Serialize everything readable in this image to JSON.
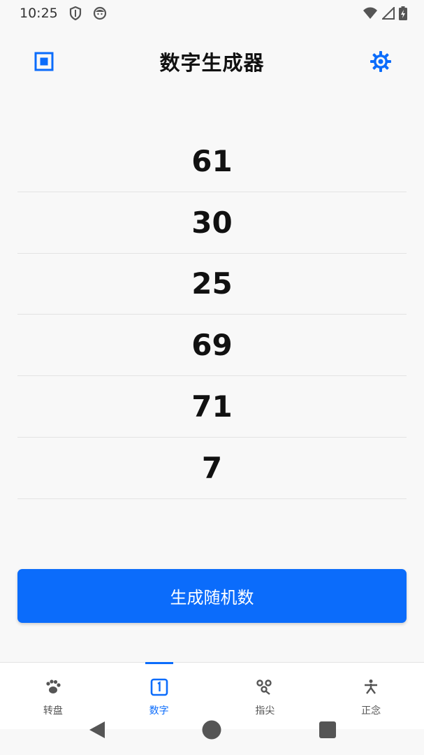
{
  "status_bar": {
    "time": "10:25",
    "icons": [
      "shield-icon",
      "face-icon",
      "wifi-icon",
      "signal-icon",
      "battery-charging-icon"
    ]
  },
  "app_bar": {
    "title": "数字生成器",
    "left_icon": "stop-square-icon",
    "right_icon": "gear-icon"
  },
  "numbers": [
    "61",
    "30",
    "25",
    "69",
    "71",
    "7"
  ],
  "generate_button": {
    "label": "生成随机数"
  },
  "bottom_nav": {
    "items": [
      {
        "label": "转盘",
        "icon": "paw-icon",
        "active": false
      },
      {
        "label": "数字",
        "icon": "number-one-box-icon",
        "active": true
      },
      {
        "label": "指尖",
        "icon": "fingertips-icon",
        "active": false
      },
      {
        "label": "正念",
        "icon": "meditation-icon",
        "active": false
      }
    ]
  },
  "system_nav": {
    "buttons": [
      "back-icon",
      "home-icon",
      "recents-icon"
    ]
  },
  "colors": {
    "accent": "#0b6cfb",
    "background": "#f8f8f8",
    "text": "#111111"
  }
}
